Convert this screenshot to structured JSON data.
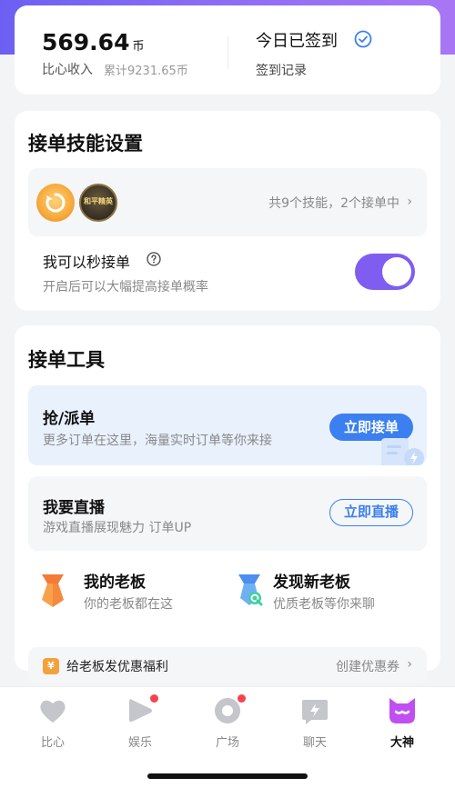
{
  "income": {
    "amount": "569.64",
    "unit": "币",
    "label": "比心收入",
    "total": "累计9231.65币"
  },
  "checkin": {
    "title": "今日已签到",
    "record": "签到记录"
  },
  "skills": {
    "title": "接单技能设置",
    "badge_game_text": "和平精英",
    "summary": "共9个技能，2个接单中",
    "instant_title": "我可以秒接单",
    "instant_sub": "开启后可以大幅提高接单概率",
    "instant_on": true
  },
  "tools": {
    "title": "接单工具",
    "grab_title": "抢/派单",
    "grab_sub": "更多订单在这里，海量实时订单等你来接",
    "grab_button": "立即接单",
    "live_title": "我要直播",
    "live_sub": "游戏直播展现魅力 订单UP",
    "live_button": "立即直播",
    "my_boss_title": "我的老板",
    "my_boss_sub": "你的老板都在这",
    "find_boss_title": "发现新老板",
    "find_boss_sub": "优质老板等你来聊",
    "promo_icon": "¥",
    "promo_text": "给老板发优惠福利",
    "promo_action": "创建优惠券"
  },
  "nav": {
    "items": [
      {
        "label": "比心",
        "icon": "heart-icon"
      },
      {
        "label": "娱乐",
        "icon": "play-icon",
        "dot": true
      },
      {
        "label": "广场",
        "icon": "circle-icon",
        "dot": true
      },
      {
        "label": "聊天",
        "icon": "chat-icon"
      },
      {
        "label": "大神",
        "icon": "master-icon",
        "active": true
      }
    ]
  },
  "colors": {
    "accent": "#7e5df0",
    "blue": "#3b7ff0",
    "badge_red": "#f5424c"
  }
}
